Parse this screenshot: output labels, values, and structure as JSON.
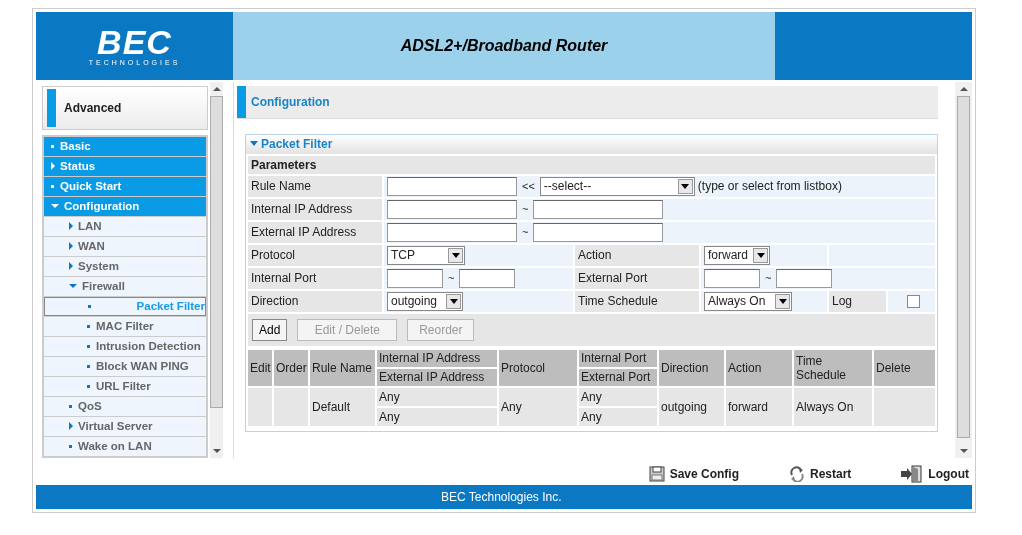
{
  "header": {
    "logo": "BEC",
    "logo_tagline": "TECHNOLOGIES",
    "title": "ADSL2+/Broadband Router"
  },
  "sidebar": {
    "heading": "Advanced",
    "items": [
      {
        "label": "Basic",
        "expandable": false,
        "selected": false
      },
      {
        "label": "Status",
        "expandable": true,
        "expanded": false,
        "selected": false
      },
      {
        "label": "Quick Start",
        "expandable": false,
        "selected": false
      },
      {
        "label": "Configuration",
        "expandable": true,
        "expanded": true,
        "selected": false,
        "children": [
          {
            "label": "LAN",
            "expandable": true,
            "expanded": false,
            "selected": false
          },
          {
            "label": "WAN",
            "expandable": true,
            "expanded": false,
            "selected": false
          },
          {
            "label": "System",
            "expandable": true,
            "expanded": false,
            "selected": false
          },
          {
            "label": "Firewall",
            "expandable": true,
            "expanded": true,
            "selected": false,
            "children": [
              {
                "label": "Packet Filter",
                "expandable": false,
                "selected": true
              },
              {
                "label": "MAC Filter",
                "expandable": false,
                "selected": false
              },
              {
                "label": "Intrusion Detection",
                "expandable": false,
                "selected": false
              },
              {
                "label": "Block WAN PING",
                "expandable": false,
                "selected": false
              },
              {
                "label": "URL Filter",
                "expandable": false,
                "selected": false
              }
            ]
          },
          {
            "label": "QoS",
            "expandable": false,
            "selected": false
          },
          {
            "label": "Virtual Server",
            "expandable": true,
            "expanded": false,
            "selected": false
          },
          {
            "label": "Wake on LAN",
            "expandable": false,
            "selected": false
          }
        ]
      }
    ]
  },
  "page_title": "Configuration",
  "panel": {
    "title": "Packet Filter",
    "expanded": true
  },
  "form": {
    "heading": "Parameters",
    "rule_name": {
      "label": "Rule Name",
      "separator": "<<",
      "select": "--select--",
      "hint": "(type or select from listbox)"
    },
    "internal_ip": {
      "label": "Internal IP Address",
      "separator": "~"
    },
    "external_ip": {
      "label": "External IP Address",
      "separator": "~"
    },
    "protocol": {
      "label": "Protocol",
      "value": "TCP"
    },
    "action": {
      "label": "Action",
      "value": "forward"
    },
    "internal_port": {
      "label": "Internal Port",
      "separator": "~"
    },
    "external_port": {
      "label": "External Port",
      "separator": "~"
    },
    "direction": {
      "label": "Direction",
      "value": "outgoing"
    },
    "time_schedule": {
      "label": "Time Schedule",
      "value": "Always On"
    },
    "log": {
      "label": "Log",
      "checked": false
    }
  },
  "buttons": [
    {
      "label": "Add",
      "disabled": false
    },
    {
      "label": "Edit / Delete",
      "disabled": true
    },
    {
      "label": "Reorder",
      "disabled": true
    }
  ],
  "table": {
    "columns": {
      "edit": "Edit",
      "order": "Order",
      "rule_name": "Rule Name",
      "internal_ip": "Internal IP Address",
      "external_ip": "External IP Address",
      "protocol": "Protocol",
      "internal_port": "Internal Port",
      "external_port": "External Port",
      "direction": "Direction",
      "action": "Action",
      "time_schedule": "Time Schedule",
      "delete": "Delete"
    },
    "rows": [
      {
        "rule_name": "Default",
        "internal_ip": "Any",
        "external_ip": "Any",
        "protocol": "Any",
        "internal_port": "Any",
        "external_port": "Any",
        "direction": "outgoing",
        "action": "forward",
        "time_schedule": "Always On"
      }
    ]
  },
  "footer_links": [
    {
      "kind": "save",
      "label": "Save Config"
    },
    {
      "kind": "restart",
      "label": "Restart"
    },
    {
      "kind": "logout",
      "label": "Logout"
    }
  ],
  "footer": "BEC Technologies Inc."
}
